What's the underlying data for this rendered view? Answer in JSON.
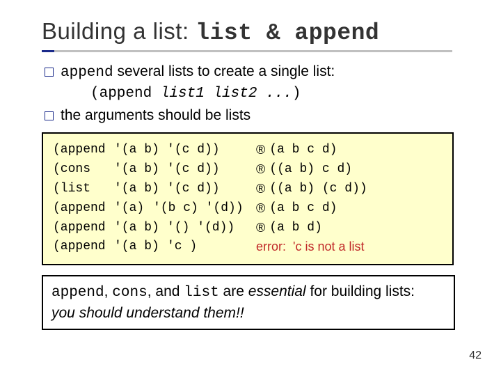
{
  "title": {
    "pre": "Building a list:  ",
    "mono": "list & append"
  },
  "bullet1": {
    "pre": "",
    "mono": "append",
    "post": " several lists to create a single list:"
  },
  "syntax": {
    "open": "(append ",
    "args": "list1 list2 ...",
    "close": ")"
  },
  "bullet2": "the arguments should be lists",
  "rows": [
    {
      "fn": "(append",
      "a": "'(a b)",
      "b": "'(c d))",
      "arrow": "®",
      "r": "(a b c d)"
    },
    {
      "fn": "(cons",
      "a": "'(a b)",
      "b": "'(c d))",
      "arrow": "®",
      "r": "((a b) c d)"
    },
    {
      "fn": "(list",
      "a": "'(a b)",
      "b": "'(c d))",
      "arrow": "®",
      "r": "((a b) (c d))"
    },
    {
      "fn": "(append",
      "a": "'(a)",
      "b": "'(b c) '(d))",
      "arrow": "®",
      "r": "(a b c d)"
    },
    {
      "fn": "(append",
      "a": "'(a b)",
      "b": "'() '(d))",
      "arrow": "®",
      "r": "(a b d)"
    },
    {
      "fn": "(append",
      "a": "'(a b)",
      "b": "'c )",
      "arrow": "",
      "r": "error:  'c is not a list",
      "err": true
    }
  ],
  "note": {
    "f1": "append",
    "c1": ", ",
    "f2": "cons",
    "c2": ", and ",
    "f3": "list",
    "c3": " are ",
    "emph": "essential",
    "c4": " for building lists:",
    "line2": "you should understand them!!"
  },
  "page": "42"
}
